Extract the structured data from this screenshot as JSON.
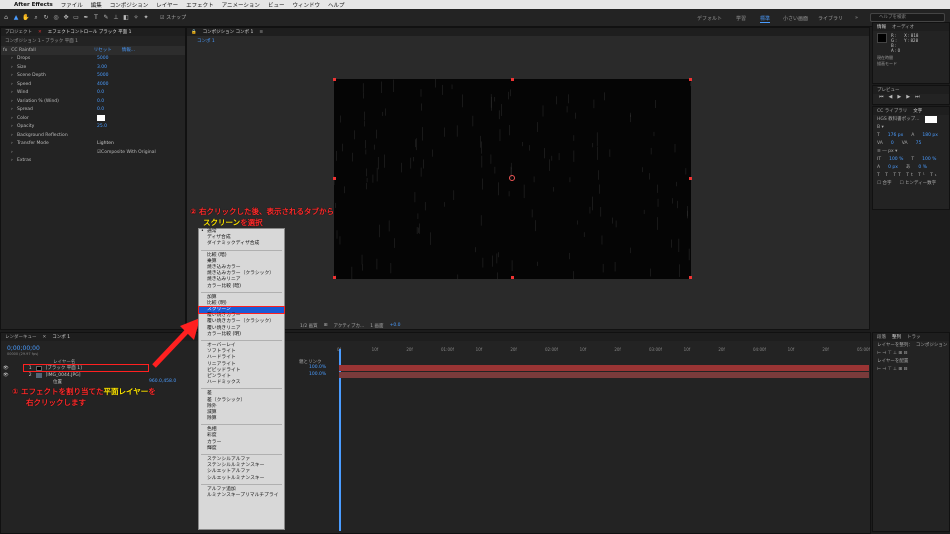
{
  "menubar": {
    "apple": "",
    "app": "After Effects",
    "items": [
      "ファイル",
      "編集",
      "コンポジション",
      "レイヤー",
      "エフェクト",
      "アニメーション",
      "ビュー",
      "ウィンドウ",
      "ヘルプ"
    ]
  },
  "toolbar": {
    "snap_label": "スナップ",
    "workspaces": [
      "デフォルト",
      "学習",
      "標準",
      "小さい画面",
      "ライブラリ"
    ],
    "active_workspace": "標準",
    "search_placeholder": "ヘルプを検索"
  },
  "left_panel": {
    "tab_project": "プロジェクト",
    "tab_effects": "エフェクトコントロール ブラック 平面 1",
    "breadcrumb": "コンポジション 1・ブラック 平面 1",
    "effect_name": "CC Rainfall",
    "reset": "リセット",
    "about": "情報...",
    "rows": [
      {
        "label": "Drops",
        "value": "5000"
      },
      {
        "label": "Size",
        "value": "3.00"
      },
      {
        "label": "Scene Depth",
        "value": "5000"
      },
      {
        "label": "Speed",
        "value": "4000"
      },
      {
        "label": "Wind",
        "value": "0.0"
      },
      {
        "label": "Variation % (Wind)",
        "value": "0.0"
      },
      {
        "label": "Spread",
        "value": "0.0"
      },
      {
        "label": "Color",
        "value": ""
      },
      {
        "label": "Opacity",
        "value": "25.0"
      },
      {
        "label": "Background Reflection",
        "value": ""
      },
      {
        "label": "Transfer Mode",
        "value": "Lighten"
      },
      {
        "label": "",
        "value": "Composite With Original"
      },
      {
        "label": "Extras",
        "value": ""
      }
    ]
  },
  "comp_panel": {
    "tab": "コンポジション コンポ 1",
    "subtab": "コンポ 1",
    "footer": {
      "zoom": "1/2 画質",
      "resolution": "アクティブカ...",
      "views": "1 画面",
      "exposure": "+0.0"
    }
  },
  "annotations": {
    "top_line1": "② 右クリックした後、表示されるタブから",
    "top_line2_highlight": "スクリーン",
    "top_line2_rest": "を選択",
    "bottom_line1": "① エフェクトを割り当てた",
    "bottom_line1_highlight": "平面レイヤー",
    "bottom_line1_rest": "を",
    "bottom_line2": "右クリックします"
  },
  "context_menu": {
    "groups": [
      [
        "通常",
        "ディザ合成",
        "ダイナミックディザ合成"
      ],
      [
        "比較 (暗)",
        "乗算",
        "焼き込みカラー",
        "焼き込みカラー（クラシック）",
        "焼き込みリニア",
        "カラー比較 (暗)"
      ],
      [
        "加算",
        "比較 (明)",
        "スクリーン",
        "覆い焼きカラー",
        "覆い焼きカラー（クラシック）",
        "覆い焼きリニア",
        "カラー比較 (明)"
      ],
      [
        "オーバーレイ",
        "ソフトライト",
        "ハードライト",
        "リニアライト",
        "ビビッドライト",
        "ピンライト",
        "ハードミックス"
      ],
      [
        "差",
        "差（クラシック）",
        "除外",
        "減算",
        "除算"
      ],
      [
        "色相",
        "彩度",
        "カラー",
        "輝度"
      ],
      [
        "ステンシルアルファ",
        "ステンシルルミナンスキー",
        "シルエットアルファ",
        "シルエットルミナンスキー"
      ],
      [
        "アルファ追加",
        "ルミナンスキープリマルチプライ"
      ]
    ],
    "selected": "スクリーン",
    "checked": "通常"
  },
  "timeline": {
    "tab_render": "レンダーキュー",
    "tab_comp": "コンポ 1",
    "timecode": "0;00;00;00",
    "timecode_sub": "00000 (29.97 fps)",
    "col_layer": "レイヤー名",
    "col_parent": "親とリンク",
    "layers": [
      {
        "num": "1",
        "name": "[ブラック 平面 1]",
        "parent": "なし"
      },
      {
        "num": "2",
        "name": "[IMG_0044.JPG]",
        "parent": "なし"
      }
    ],
    "position_label": "位置",
    "position_value": "960.0,458.0",
    "percent1": "100.0%",
    "percent2": "100.0%",
    "ruler": [
      "0f",
      "10f",
      "20f",
      "01:00f",
      "10f",
      "20f",
      "02:00f",
      "10f",
      "20f",
      "03:00f",
      "10f",
      "20f",
      "04:00f",
      "10f",
      "20f",
      "05:00f"
    ]
  },
  "right_panel": {
    "info_tab": "情報",
    "audio_tab": "オーディオ",
    "info_vals": [
      "R :",
      "G :",
      "B :",
      "A : 0"
    ],
    "coords": [
      "X : 818",
      "Y : 828"
    ],
    "info_footer": [
      "現在時間",
      "描画モード"
    ],
    "preview_tab": "プレビュー",
    "library_tab": "CC ライブラリ",
    "char_tab": "文字",
    "font": "HGS 教科書ポップ...",
    "px_size": "176 px",
    "px_val": "180 px",
    "tracking": "0",
    "metric": "75",
    "pct1": "100 %",
    "pct2": "100 %",
    "baseline": "0 px",
    "pct3": "0 %",
    "ligature": "合字",
    "hindi": "ヒンディー数字",
    "align_tab1": "段落",
    "align_tab2": "整列",
    "tracker_tab": "トラッ",
    "align_label": "レイヤーを整列：",
    "align_target": "コンポジション",
    "distribute": "レイヤーを配置"
  }
}
